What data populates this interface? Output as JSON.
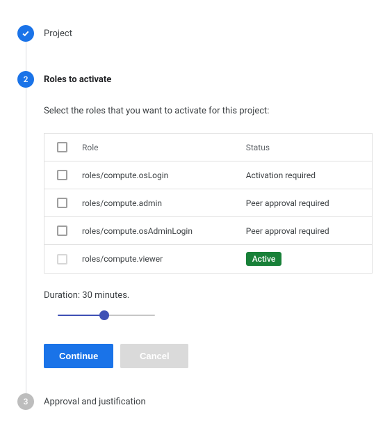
{
  "steps": {
    "s1": {
      "label": "Project",
      "icon": "check"
    },
    "s2": {
      "label": "Roles to activate",
      "number": "2"
    },
    "s3": {
      "label": "Approval and justification",
      "number": "3"
    }
  },
  "body": {
    "description": "Select the roles that you want to activate for this project:",
    "headers": {
      "role": "Role",
      "status": "Status"
    },
    "rows": [
      {
        "role": "roles/compute.osLogin",
        "status": "Activation required",
        "disabled": false
      },
      {
        "role": "roles/compute.admin",
        "status": "Peer approval required",
        "disabled": false
      },
      {
        "role": "roles/compute.osAdminLogin",
        "status": "Peer approval required",
        "disabled": false
      },
      {
        "role": "roles/compute.viewer",
        "status_badge": "Active",
        "disabled": true
      }
    ],
    "duration_label": "Duration: 30 minutes.",
    "buttons": {
      "continue": "Continue",
      "cancel": "Cancel"
    }
  }
}
